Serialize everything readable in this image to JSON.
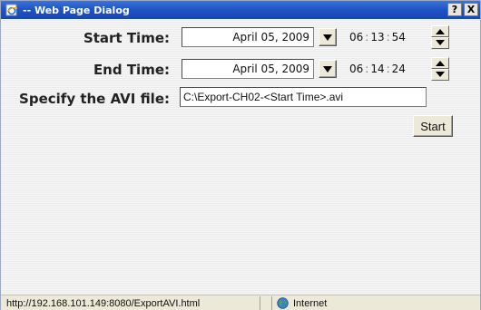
{
  "window": {
    "title": "-- Web Page Dialog",
    "help_label": "?",
    "close_label": "X"
  },
  "form": {
    "start_label": "Start Time:",
    "start_date": "April 05, 2009",
    "start_hour": "06",
    "start_minute": "13",
    "start_second": "54",
    "end_label": "End Time:",
    "end_date": "April 05, 2009",
    "end_hour": "06",
    "end_minute": "14",
    "end_second": "24",
    "avi_label": "Specify the AVI file:",
    "avi_value": "C:\\Export-CH02-<Start Time>.avi",
    "time_separator": ":",
    "start_button_label": "Start"
  },
  "status": {
    "url": "http://192.168.101.149:8080/ExportAVI.html",
    "zone": "Internet"
  },
  "icons": {
    "title_icon": "ie-page-icon",
    "date_dropdown": "chevron-down-icon",
    "spin_up": "triangle-up-icon",
    "spin_down": "triangle-down-icon",
    "zone_icon": "globe-icon"
  },
  "colors": {
    "titlebar": "#1f55c6",
    "dialog_bg": "#f0f0f0",
    "button_face": "#ece9d8"
  }
}
